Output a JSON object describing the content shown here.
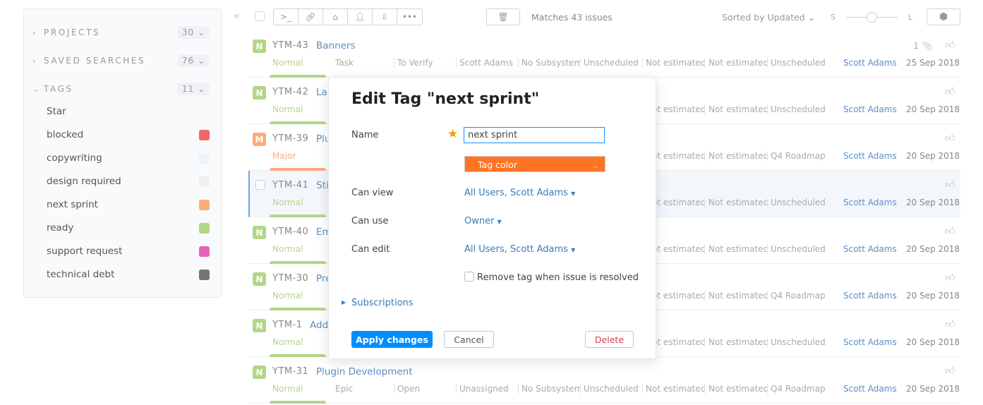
{
  "sidebar": {
    "sections": [
      {
        "label": "PROJECTS",
        "count": "30",
        "expanded": false
      },
      {
        "label": "SAVED SEARCHES",
        "count": "76",
        "expanded": false
      },
      {
        "label": "TAGS",
        "count": "11",
        "expanded": true
      }
    ],
    "tags": [
      {
        "name": "Star",
        "color": ""
      },
      {
        "name": "blocked",
        "color": "#ee6668"
      },
      {
        "name": "copywriting",
        "color": "#eaf5fd"
      },
      {
        "name": "design required",
        "color": "#f0f0f0"
      },
      {
        "name": "next sprint",
        "color": "#fdab78"
      },
      {
        "name": "ready",
        "color": "#b2d688"
      },
      {
        "name": "support request",
        "color": "#e862b7"
      },
      {
        "name": "technical debt",
        "color": "#757575"
      }
    ]
  },
  "toolbar": {
    "collapse_icon": "double-chevron-left",
    "tools": [
      "command-icon",
      "link-icon",
      "tag-icon",
      "user-icon",
      "export-icon",
      "more-icon"
    ],
    "delete_icon": "trash-icon",
    "matches": "Matches 43 issues",
    "sort": "Sorted by Updated",
    "size_small": "S",
    "size_large": "L",
    "size_value": 0.5,
    "settings_icon": "gear-icon"
  },
  "issues": [
    {
      "id": "YTM-43",
      "badge": "N",
      "badge_color": "#b2d688",
      "title": "Banners",
      "priority": "Normal",
      "fields": [
        "Task",
        "To Verify",
        "Scott Adams",
        "No Subsystem",
        "Unscheduled",
        "Not estimated",
        "Not estimated",
        "Unscheduled"
      ],
      "reporter": "Scott Adams",
      "date": "25 Sep 2018",
      "attachments": "1"
    },
    {
      "id": "YTM-42",
      "badge": "N",
      "badge_color": "#b2d688",
      "title": "La",
      "priority": "Normal",
      "fields": [
        "",
        "",
        "",
        "",
        "",
        "Not estimated",
        "Not estimated",
        "Unscheduled"
      ],
      "reporter": "Scott Adams",
      "date": "20 Sep 2018"
    },
    {
      "id": "YTM-39",
      "badge": "M",
      "badge_color": "#fdab78",
      "title": "Plu",
      "priority": "Major",
      "fields": [
        "",
        "",
        "",
        "",
        "",
        "Not estimated",
        "Not estimated",
        "Q4 Roadmap"
      ],
      "reporter": "Scott Adams",
      "date": "20 Sep 2018"
    },
    {
      "id": "YTM-41",
      "badge": "",
      "badge_color": "",
      "title": "Sti",
      "priority": "Normal",
      "fields": [
        "",
        "",
        "",
        "",
        "",
        "Not estimated",
        "Not estimated",
        "Unscheduled"
      ],
      "reporter": "Scott Adams",
      "date": "20 Sep 2018"
    },
    {
      "id": "YTM-40",
      "badge": "N",
      "badge_color": "#b2d688",
      "title": "Em",
      "priority": "Normal",
      "fields": [
        "",
        "",
        "",
        "",
        "",
        "Not estimated",
        "Not estimated",
        "Unscheduled"
      ],
      "reporter": "Scott Adams",
      "date": "20 Sep 2018"
    },
    {
      "id": "YTM-30",
      "badge": "N",
      "badge_color": "#b2d688",
      "title": "Pre",
      "priority": "Normal",
      "fields": [
        "",
        "",
        "",
        "",
        "",
        "Not estimated",
        "Not estimated",
        "Q4 Roadmap"
      ],
      "reporter": "Scott Adams",
      "date": "20 Sep 2018"
    },
    {
      "id": "YTM-1",
      "badge": "N",
      "badge_color": "#b2d688",
      "title": "Add",
      "priority": "Normal",
      "fields": [
        "",
        "",
        "",
        "",
        "",
        "Not estimated",
        "Not estimated",
        "Unscheduled"
      ],
      "reporter": "Scott Adams",
      "date": "20 Sep 2018"
    },
    {
      "id": "YTM-31",
      "badge": "N",
      "badge_color": "#b2d688",
      "title": "Plugin Development",
      "priority": "Normal",
      "fields": [
        "Epic",
        "Open",
        "Unassigned",
        "No Subsystem",
        "Unscheduled",
        "Not estimated",
        "Not estimated",
        "Q4 Roadmap"
      ],
      "reporter": "Scott Adams",
      "date": "20 Sep 2018"
    }
  ],
  "modal": {
    "title": "Edit Tag \"next sprint\"",
    "name_label": "Name",
    "name_value": "next sprint",
    "tag_color_label": "Tag color",
    "tag_color": "#ff7424",
    "can_view_label": "Can view",
    "can_view": "All Users, Scott Adams",
    "can_use_label": "Can use",
    "can_use": "Owner",
    "can_edit_label": "Can edit",
    "can_edit": "All Users, Scott Adams",
    "remove_label": "Remove tag when issue is resolved",
    "remove_checked": false,
    "subscriptions": "Subscriptions",
    "apply": "Apply changes",
    "cancel": "Cancel",
    "delete": "Delete"
  },
  "colors": {
    "accent": "#008eff",
    "link": "#3a7ab8",
    "normal": "#b2d688",
    "major": "#fdab78",
    "danger": "#d3424b"
  }
}
